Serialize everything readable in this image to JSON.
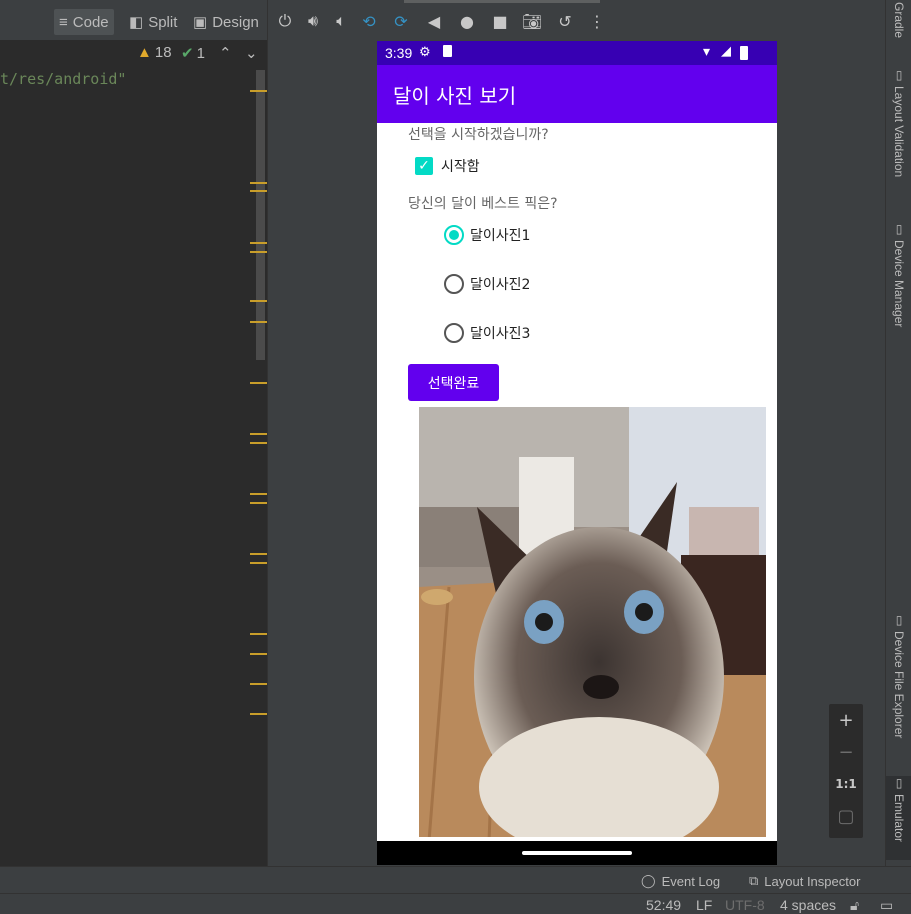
{
  "editor": {
    "view_modes": [
      "Code",
      "Split",
      "Design"
    ],
    "code_snippet": "t/res/android\"",
    "warnings_count": "18",
    "checks_count": "1"
  },
  "device": {
    "status_time": "3:39",
    "app_title": "달이 사진 보기",
    "question1": "선택을 시작하겠습니까?",
    "checkbox_label": "시작함",
    "question2": "당신의 달이 베스트 픽은?",
    "radio_options": [
      "달이사진1",
      "달이사진2",
      "달이사진3"
    ],
    "selected_radio": 0,
    "button_label": "선택완료",
    "accent_color": "#03dac5",
    "primary_color": "#6200ee",
    "status_color": "#3700b3"
  },
  "zoom_controls": [
    "+",
    "−",
    "1:1"
  ],
  "right_tabs": [
    "Gradle",
    "Layout Validation",
    "Device Manager",
    "Device File Explorer",
    "Emulator"
  ],
  "bottom_bar": {
    "event_log": "Event Log",
    "layout_inspector": "Layout Inspector"
  },
  "status_bar": {
    "position": "52:49",
    "line_sep": "LF",
    "encoding": "UTF-8",
    "indent": "4 spaces"
  }
}
